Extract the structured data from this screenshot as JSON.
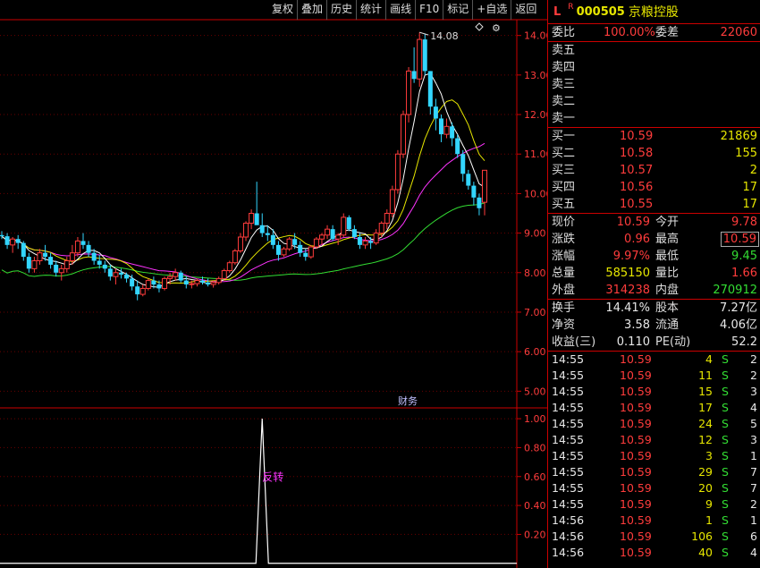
{
  "toolbar": [
    "复权",
    "叠加",
    "历史",
    "统计",
    "画线",
    "F10",
    "标记",
    "+自选",
    "返回"
  ],
  "header": {
    "flag_l": "L",
    "flag_r": "R",
    "code": "000505",
    "name": "京粮控股"
  },
  "ratio": {
    "label1": "委比",
    "val1": "100.00%",
    "label2": "委差",
    "val2": "22060"
  },
  "asks": [
    {
      "label": "卖五"
    },
    {
      "label": "卖四"
    },
    {
      "label": "卖三"
    },
    {
      "label": "卖二"
    },
    {
      "label": "卖一"
    }
  ],
  "bids": [
    {
      "label": "买一",
      "price": "10.59",
      "vol": "21869"
    },
    {
      "label": "买二",
      "price": "10.58",
      "vol": "155"
    },
    {
      "label": "买三",
      "price": "10.57",
      "vol": "2"
    },
    {
      "label": "买四",
      "price": "10.56",
      "vol": "17"
    },
    {
      "label": "买五",
      "price": "10.55",
      "vol": "17"
    }
  ],
  "quote": {
    "l1": "现价",
    "v1": "10.59",
    "l2": "今开",
    "v2": "9.78",
    "l3": "涨跌",
    "v3": "0.96",
    "l4": "最高",
    "v4": "10.59",
    "l5": "涨幅",
    "v5": "9.97%",
    "l6": "最低",
    "v6": "9.45",
    "l7": "总量",
    "v7": "585150",
    "l8": "量比",
    "v8": "1.66",
    "l9": "外盘",
    "v9": "314238",
    "l10": "内盘",
    "v10": "270912"
  },
  "fin": {
    "l1": "换手",
    "v1": "14.41%",
    "l2": "股本",
    "v2": "7.27亿",
    "l3": "净资",
    "v3": "3.58",
    "l4": "流通",
    "v4": "4.06亿",
    "l5": "收益(三)",
    "v5": "0.110",
    "l6": "PE(动)",
    "v6": "52.2"
  },
  "ticks": [
    {
      "time": "14:55",
      "price": "10.59",
      "vol": "4",
      "side": "S",
      "n": "2"
    },
    {
      "time": "14:55",
      "price": "10.59",
      "vol": "11",
      "side": "S",
      "n": "2"
    },
    {
      "time": "14:55",
      "price": "10.59",
      "vol": "15",
      "side": "S",
      "n": "3"
    },
    {
      "time": "14:55",
      "price": "10.59",
      "vol": "17",
      "side": "S",
      "n": "4"
    },
    {
      "time": "14:55",
      "price": "10.59",
      "vol": "24",
      "side": "S",
      "n": "5"
    },
    {
      "time": "14:55",
      "price": "10.59",
      "vol": "12",
      "side": "S",
      "n": "3"
    },
    {
      "time": "14:55",
      "price": "10.59",
      "vol": "3",
      "side": "S",
      "n": "1"
    },
    {
      "time": "14:55",
      "price": "10.59",
      "vol": "29",
      "side": "S",
      "n": "7"
    },
    {
      "time": "14:55",
      "price": "10.59",
      "vol": "20",
      "side": "S",
      "n": "7"
    },
    {
      "time": "14:55",
      "price": "10.59",
      "vol": "9",
      "side": "S",
      "n": "2"
    },
    {
      "time": "14:56",
      "price": "10.59",
      "vol": "1",
      "side": "S",
      "n": "1"
    },
    {
      "time": "14:56",
      "price": "10.59",
      "vol": "106",
      "side": "S",
      "n": "6"
    },
    {
      "time": "14:56",
      "price": "10.59",
      "vol": "40",
      "side": "S",
      "n": "4"
    }
  ],
  "chart_labels": {
    "high_label": "14.08",
    "event_label": "财务",
    "indicator_label": "反转"
  },
  "colors": {
    "up": "#ff3c3c",
    "down": "#33d6ff",
    "ma5": "#ffffff",
    "ma10": "#e6e600",
    "ma20": "#ff33ff",
    "ma60": "#33dd33",
    "indicator": "#ffffff"
  },
  "chart_data": [
    {
      "type": "candlestick",
      "yaxis_ticks": [
        "14.00",
        "13.00",
        "12.00",
        "11.00",
        "10.00",
        "9.00",
        "8.00",
        "7.00",
        "6.00",
        "5.00"
      ],
      "ylim": [
        4.6,
        14.4
      ],
      "high": 14.08,
      "candles": [
        [
          8.95,
          9.05,
          8.85,
          8.92
        ],
        [
          8.92,
          9.0,
          8.6,
          8.7
        ],
        [
          8.7,
          8.9,
          8.5,
          8.85
        ],
        [
          8.85,
          8.95,
          8.6,
          8.75
        ],
        [
          8.75,
          8.8,
          8.3,
          8.4
        ],
        [
          8.4,
          8.5,
          8.0,
          8.1
        ],
        [
          8.1,
          8.4,
          8.0,
          8.3
        ],
        [
          8.3,
          8.6,
          8.2,
          8.5
        ],
        [
          8.5,
          8.7,
          8.3,
          8.4
        ],
        [
          8.4,
          8.5,
          8.1,
          8.2
        ],
        [
          8.2,
          8.3,
          7.9,
          8.0
        ],
        [
          8.0,
          8.2,
          7.8,
          8.1
        ],
        [
          8.1,
          8.4,
          8.0,
          8.3
        ],
        [
          8.3,
          8.7,
          8.2,
          8.5
        ],
        [
          8.5,
          8.9,
          8.4,
          8.8
        ],
        [
          8.8,
          9.0,
          8.6,
          8.7
        ],
        [
          8.7,
          8.8,
          8.4,
          8.5
        ],
        [
          8.5,
          8.6,
          8.2,
          8.3
        ],
        [
          8.3,
          8.45,
          8.1,
          8.2
        ],
        [
          8.2,
          8.3,
          8.0,
          8.1
        ],
        [
          8.1,
          8.2,
          7.8,
          7.9
        ],
        [
          7.9,
          8.1,
          7.7,
          8.0
        ],
        [
          8.0,
          8.1,
          7.85,
          7.95
        ],
        [
          7.95,
          8.0,
          7.75,
          7.85
        ],
        [
          7.85,
          7.95,
          7.55,
          7.65
        ],
        [
          7.65,
          7.8,
          7.3,
          7.45
        ],
        [
          7.45,
          7.7,
          7.4,
          7.6
        ],
        [
          7.6,
          7.85,
          7.55,
          7.8
        ],
        [
          7.8,
          7.9,
          7.6,
          7.7
        ],
        [
          7.7,
          7.8,
          7.5,
          7.6
        ],
        [
          7.6,
          7.9,
          7.55,
          7.85
        ],
        [
          7.85,
          8.0,
          7.7,
          7.9
        ],
        [
          7.9,
          8.1,
          7.8,
          8.0
        ],
        [
          8.0,
          8.05,
          7.75,
          7.8
        ],
        [
          7.8,
          7.9,
          7.6,
          7.7
        ],
        [
          7.7,
          7.8,
          7.6,
          7.72
        ],
        [
          7.72,
          7.85,
          7.65,
          7.8
        ],
        [
          7.8,
          7.9,
          7.7,
          7.75
        ],
        [
          7.75,
          7.85,
          7.65,
          7.7
        ],
        [
          7.7,
          7.8,
          7.62,
          7.75
        ],
        [
          7.75,
          7.9,
          7.7,
          7.85
        ],
        [
          7.85,
          8.1,
          7.8,
          8.05
        ],
        [
          8.05,
          8.3,
          8.0,
          8.25
        ],
        [
          8.25,
          8.6,
          8.2,
          8.55
        ],
        [
          8.55,
          9.0,
          8.5,
          8.9
        ],
        [
          8.9,
          9.3,
          8.8,
          9.25
        ],
        [
          9.25,
          9.6,
          9.1,
          9.5
        ],
        [
          9.5,
          10.3,
          9.4,
          9.2
        ],
        [
          9.2,
          9.5,
          8.9,
          9.0
        ],
        [
          9.0,
          9.2,
          8.8,
          8.95
        ],
        [
          8.95,
          9.1,
          8.6,
          8.7
        ],
        [
          8.7,
          8.8,
          8.3,
          8.45
        ],
        [
          8.45,
          8.65,
          8.4,
          8.6
        ],
        [
          8.6,
          8.9,
          8.55,
          8.85
        ],
        [
          8.85,
          9.0,
          8.6,
          8.7
        ],
        [
          8.7,
          8.8,
          8.4,
          8.5
        ],
        [
          8.5,
          8.6,
          8.3,
          8.4
        ],
        [
          8.4,
          8.7,
          8.35,
          8.65
        ],
        [
          8.65,
          8.9,
          8.6,
          8.85
        ],
        [
          8.85,
          9.0,
          8.7,
          8.95
        ],
        [
          8.95,
          9.2,
          8.85,
          9.1
        ],
        [
          9.1,
          9.2,
          8.8,
          8.85
        ],
        [
          8.85,
          9.0,
          8.7,
          8.95
        ],
        [
          8.95,
          9.5,
          8.9,
          9.4
        ],
        [
          9.4,
          9.45,
          9.05,
          9.1
        ],
        [
          9.1,
          9.2,
          8.85,
          8.9
        ],
        [
          8.9,
          9.0,
          8.6,
          8.7
        ],
        [
          8.7,
          8.9,
          8.6,
          8.8
        ],
        [
          8.8,
          8.9,
          8.6,
          8.75
        ],
        [
          8.75,
          9.1,
          8.7,
          9.0
        ],
        [
          9.0,
          9.3,
          8.9,
          9.25
        ],
        [
          9.25,
          9.6,
          9.1,
          9.5
        ],
        [
          9.5,
          10.2,
          9.4,
          10.1
        ],
        [
          10.1,
          11.1,
          10.0,
          11.0
        ],
        [
          11.0,
          12.1,
          10.9,
          12.0
        ],
        [
          12.0,
          13.2,
          11.8,
          13.1
        ],
        [
          13.1,
          13.7,
          12.8,
          12.9
        ],
        [
          12.9,
          14.08,
          12.7,
          13.9
        ],
        [
          13.9,
          14.05,
          13.0,
          13.1
        ],
        [
          13.1,
          13.1,
          12.0,
          12.2
        ],
        [
          12.2,
          12.4,
          11.6,
          11.9
        ],
        [
          11.9,
          12.0,
          11.3,
          11.5
        ],
        [
          11.5,
          11.9,
          11.4,
          11.7
        ],
        [
          11.7,
          11.8,
          11.2,
          11.4
        ],
        [
          11.4,
          11.5,
          10.9,
          11.0
        ],
        [
          11.0,
          11.1,
          10.3,
          10.5
        ],
        [
          10.5,
          10.6,
          10.1,
          10.2
        ],
        [
          10.2,
          10.3,
          9.7,
          9.9
        ],
        [
          9.9,
          10.0,
          9.45,
          9.63
        ],
        [
          9.78,
          10.59,
          9.45,
          10.59
        ]
      ]
    },
    {
      "type": "line",
      "name": "反转",
      "yaxis_ticks": [
        "1.00",
        "0.80",
        "0.60",
        "0.40",
        "0.20"
      ],
      "ylim": [
        -0.02,
        1.05
      ],
      "peak_index": 48,
      "peak_value": 1.0
    }
  ]
}
